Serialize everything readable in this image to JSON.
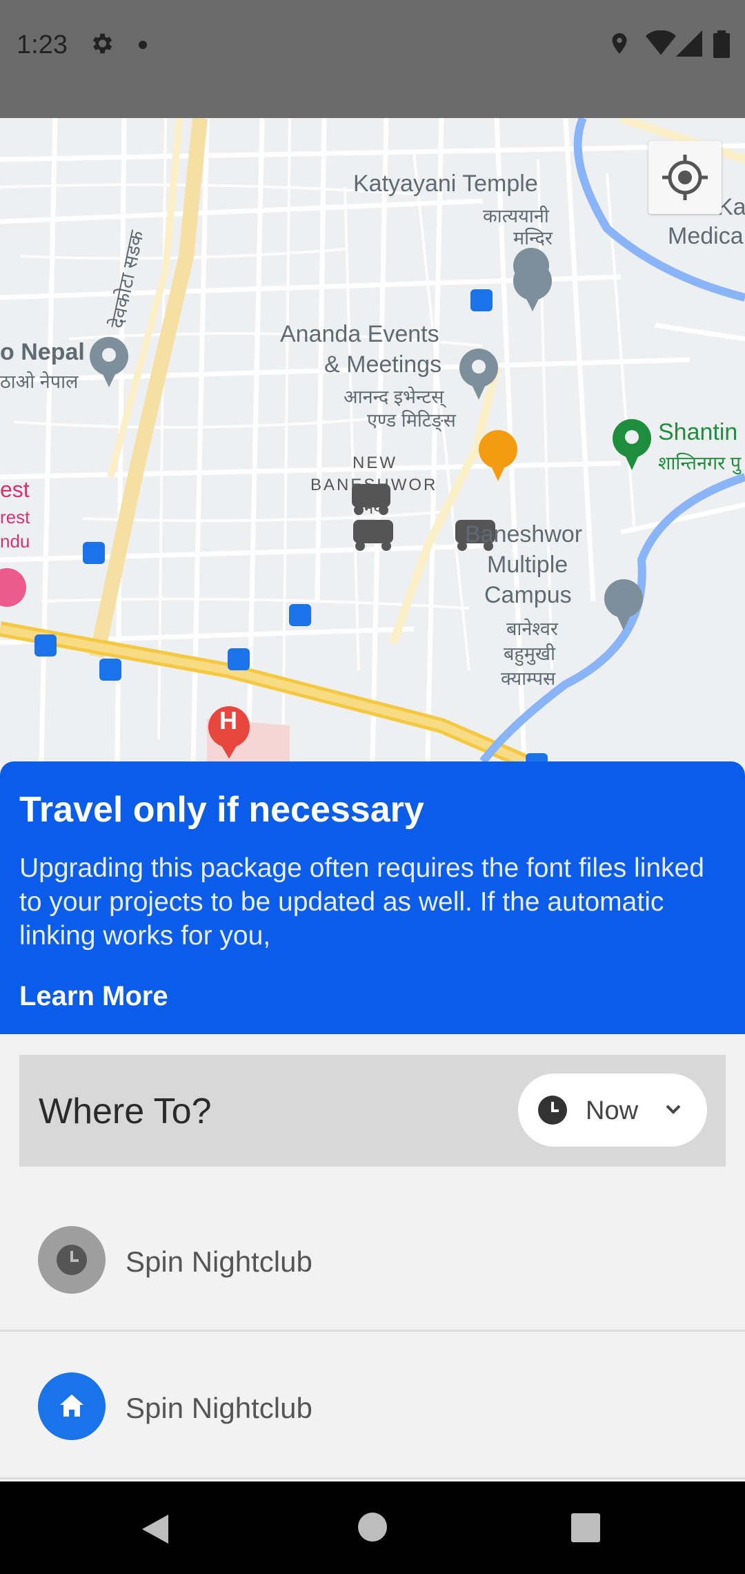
{
  "status": {
    "time": "1:23"
  },
  "map": {
    "labels": {
      "katyayani": "Katyayani Temple",
      "katyayani_np1": "कात्ययानी",
      "katyayani_np2": "मन्दिर",
      "ka": "Ka",
      "medica": "Medica",
      "ananda1": "Ananda Events",
      "ananda2": "& Meetings",
      "ananda_np1": "आनन्द इभेन्टस्",
      "ananda_np2": "एण्ड मिटिङ्स",
      "nepal": "o Nepal",
      "nepal_np": "ठाओ नेपाल",
      "road": "देवकोटा सडक",
      "new": "NEW",
      "baneshwor": "BANESHWOR",
      "naya": "नया",
      "shanti": "Shantin",
      "shanti_np": "शान्तिनगर पु",
      "campus1": "Baneshwor",
      "campus2": "Multiple",
      "campus3": "Campus",
      "campus_np1": "बानेश्वर",
      "campus_np2": "बहुमुखी",
      "campus_np3": "क्याम्पस",
      "est1": "est",
      "est2": "rest",
      "est3": "ndu",
      "hospital": "H"
    }
  },
  "banner": {
    "title": "Travel only if necessary",
    "body": "Upgrading this package often requires the font files linked to your projects to be updated as well. If the automatic linking works for you,",
    "link": "Learn More"
  },
  "search": {
    "label": "Where To?",
    "time_option": "Now"
  },
  "places": [
    {
      "label": "Spin Nightclub",
      "icon": "clock-icon"
    },
    {
      "label": "Spin Nightclub",
      "icon": "home-icon"
    }
  ],
  "colors": {
    "banner": "#0b5ce8",
    "home_circle": "#1a73e8",
    "recent_circle": "#9e9e9e"
  }
}
